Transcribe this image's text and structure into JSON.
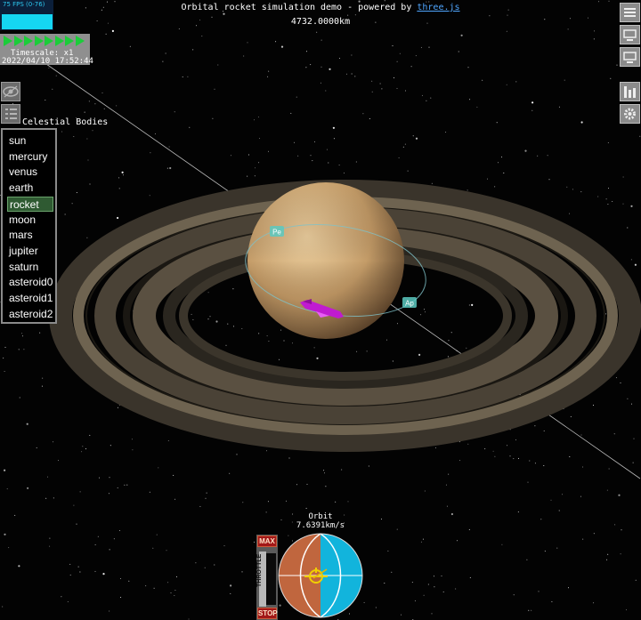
{
  "header": {
    "title_prefix": "Orbital rocket simulation demo - powered by ",
    "title_link": "three.js",
    "distance": "4732.0000km"
  },
  "fps": {
    "label": "75 FPS (0-76)",
    "value": 75,
    "min": 0,
    "max": 76
  },
  "time": {
    "play_buttons": 8,
    "timescale": "Timescale: x1",
    "datetime": "2022/04/10 17:52:44"
  },
  "left_tools": {
    "visibility_icon": "eye-icon",
    "list_icon": "list-icon"
  },
  "bodies": {
    "title": "Celestial Bodies",
    "items": [
      "sun",
      "mercury",
      "venus",
      "earth",
      "rocket",
      "moon",
      "mars",
      "jupiter",
      "saturn",
      "asteroid0",
      "asteroid1",
      "asteroid2"
    ],
    "selected": "rocket"
  },
  "right_tools": [
    "menu-icon",
    "display-icon",
    "display-icon",
    "chart-icon",
    "gear-icon"
  ],
  "markers": {
    "periapsis": "Pe",
    "apoapsis": "Ap"
  },
  "hud": {
    "mode": "Orbit",
    "speed": "7.6391km/s",
    "throttle_max": "MAX",
    "throttle_label": "THROTTLE",
    "throttle_stop": "STOP",
    "throttle_level": 0
  },
  "colors": {
    "fps_bar": "#15d6f2",
    "play": "#1ccc3a",
    "selected_item": "#2f5a32",
    "navball_ground": "#c0663e",
    "navball_sky": "#12b4dc",
    "marker": "#5bc9c1",
    "rocket": "#c01bd0"
  }
}
